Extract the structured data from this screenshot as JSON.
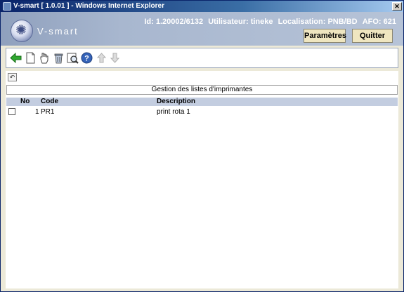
{
  "window": {
    "title": "V-smart [ 1.0.01 ] - Windows Internet Explorer",
    "close_glyph": "✕"
  },
  "header": {
    "brand": "V-smart",
    "id": "Id: 1.20002/6132",
    "user": "Utilisateur: tineke",
    "location": "Localisation: PNB/BD",
    "afo": "AFO: 621",
    "params_label": "Paramètres",
    "quit_label": "Quitter"
  },
  "toolbar": {
    "icons": [
      "back-arrow-icon",
      "new-document-icon",
      "select-hand-icon",
      "delete-bin-icon",
      "preview-icon",
      "help-icon",
      "move-up-icon",
      "move-down-icon"
    ]
  },
  "section": {
    "title": "Gestion des listes d'imprimantes"
  },
  "table": {
    "headers": {
      "no": "No",
      "code": "Code",
      "description": "Description"
    },
    "rows": [
      {
        "no": "1",
        "code": "PR1",
        "description": "print rota 1"
      }
    ]
  },
  "colors": {
    "header_bg": "#a8b7cf",
    "table_header": "#c3cde0",
    "button_bg": "#efe6c0"
  }
}
